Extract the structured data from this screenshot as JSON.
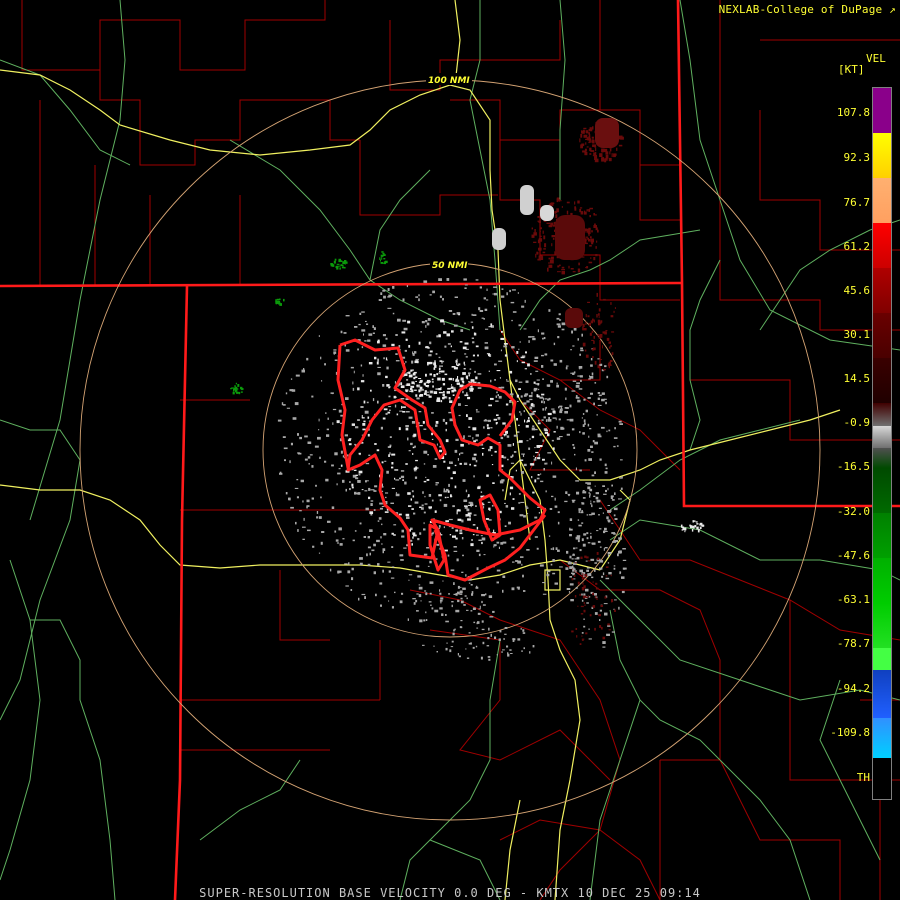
{
  "credit": "NEXLAB-College of DuPage",
  "footer": "SUPER-RESOLUTION BASE VELOCITY 0.0 DEG - KMTX 10 DEC 25 09:14",
  "legend": {
    "product": "VEL",
    "unit": "[KT]",
    "ticks": [
      "107.8",
      "92.3",
      "76.7",
      "61.2",
      "45.6",
      "30.1",
      "14.5",
      "-0.9",
      "-16.5",
      "-32.0",
      "-47.6",
      "-63.1",
      "-78.7",
      "-94.2",
      "-109.8",
      "TH"
    ],
    "colors": {
      "purple": "#8a008a",
      "yellow": "#ffff00",
      "orange": "#ffa060",
      "red": "#ff0000",
      "dark_red": "#4a0000",
      "gray": "#9a9a9a",
      "dark_green": "#004a00",
      "green": "#00cc00",
      "bright_green": "#44ff44",
      "blue": "#2060ff",
      "cyan": "#00d0ff"
    }
  },
  "range_rings": {
    "labels": [
      "100 NMI",
      "50 NMI"
    ],
    "color": "#d4a373"
  },
  "map_colors": {
    "state_border": "#ff1a1a",
    "county_line": "#b00000",
    "highway": "#ffff66",
    "road": "#6fbf6f",
    "warning_polygon": "#ff2020"
  }
}
